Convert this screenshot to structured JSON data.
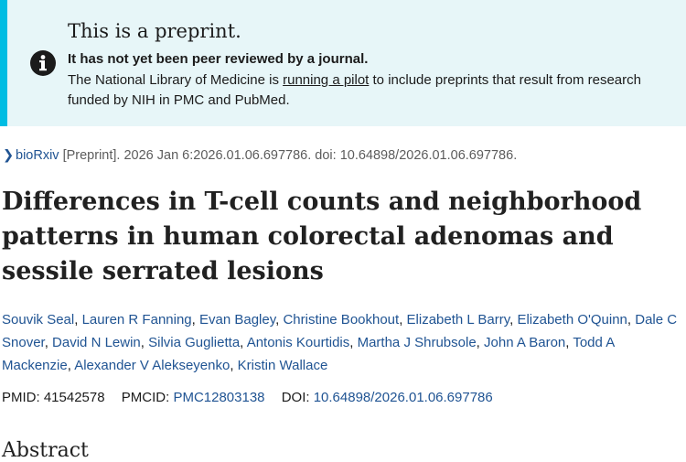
{
  "banner": {
    "title": "This is a preprint.",
    "strong": "It has not yet been peer reviewed by a journal.",
    "body_before": "The National Library of Medicine is ",
    "link": "running a pilot",
    "body_after": " to include preprints that result from research funded by NIH in PMC and PubMed.",
    "icon": "info-icon",
    "accent_color": "#00bde3",
    "background_color": "#e7f6f8"
  },
  "citation": {
    "source": "bioRxiv",
    "details": "[Preprint]. 2026 Jan 6:2026.01.06.697786. doi: 10.64898/2026.01.06.697786."
  },
  "article": {
    "title": "Differences in T-cell counts and neighborhood patterns in human colorectal adenomas and sessile serrated lesions",
    "authors": [
      "Souvik Seal",
      "Lauren R Fanning",
      "Evan Bagley",
      "Christine Bookhout",
      "Elizabeth L Barry",
      "Elizabeth O'Quinn",
      "Dale C Snover",
      "David N Lewin",
      "Silvia Guglietta",
      "Antonis Kourtidis",
      "Martha J Shrubsole",
      "John A Baron",
      "Todd A Mackenzie",
      "Alexander V Alekseyenko",
      "Kristin Wallace"
    ],
    "pmid_label": "PMID:",
    "pmid": "41542578",
    "pmcid_label": "PMCID:",
    "pmcid": "PMC12803138",
    "doi_label": "DOI:",
    "doi": "10.64898/2026.01.06.697786"
  },
  "abstract_heading": "Abstract",
  "link_color": "#205493"
}
